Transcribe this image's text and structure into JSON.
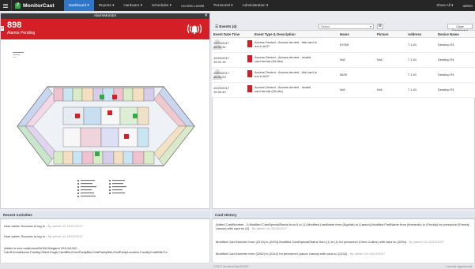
{
  "nav": {
    "menu_icon": "menu-icon",
    "brand": "MonitorCast",
    "items": [
      {
        "label": "Dashboard ▾",
        "active": true
      },
      {
        "label": "Reports ▾"
      },
      {
        "label": "Hardware ▾"
      },
      {
        "label": "Schedules ▾"
      },
      {
        "label": "Access Levels"
      },
      {
        "label": "Personnel ▾"
      },
      {
        "label": "Administration ▾"
      }
    ],
    "show_all": "Show All ▾",
    "user": "admin"
  },
  "alarm": {
    "title": "AlarmMonitor",
    "close": "✕",
    "count": "898",
    "subtitle": "Alarms Pending",
    "toggle": "≡",
    "bell_icon": "alarm-bell-icon"
  },
  "events": {
    "label": "Events (4)",
    "select_value": "Select",
    "select_arrow": "▾",
    "gear": "⚙",
    "clear_button": "Clear Dashboard",
    "columns": [
      "Event Date Time",
      "Event Type & Description",
      "Name",
      "Picture",
      "Address",
      "Device Name"
    ],
    "rows": [
      {
        "datetime": "10/20/2017 15:32:31",
        "description": "Access Denied - Access denied - this card is not in ACP",
        "name": "67006",
        "picture": "",
        "address": "7.1.#1",
        "device": "Desktop R1"
      },
      {
        "datetime": "10/20/2017 15:31:14",
        "description": "Access Denied - Access denied - Invalid card format (34 bits)",
        "name": "N/A",
        "picture": "N/A",
        "address": "7.1.#1",
        "device": "Desktop R1"
      },
      {
        "datetime": "10/20/2017 15:31:29",
        "description": "Access Denied - Access denied - this card is not in ACP",
        "name": "5829",
        "picture": "",
        "address": "7.1.#1",
        "device": "Desktop R1"
      },
      {
        "datetime": "10/20/2017 15:30:40",
        "description": "Access Denied - Access denied - Invalid card format (26 bits)",
        "name": "N/A",
        "picture": "N/A",
        "address": "7.1.#1",
        "device": "Desktop R1"
      }
    ]
  },
  "recent": {
    "title": "Recent Activities",
    "items": [
      {
        "text": "User admin Success to log in",
        "meta": " - By admin On 10/20/2017"
      },
      {
        "text": "User admin Success to log in",
        "meta": " - By admin On 10/20/2017"
      },
      {
        "text": "Added a new cardformat34 Bit Wiegand H10-N1002 - CardFormatName,Facility,Offset,Flags,CardBits,EvenParityBits,OddParityBits,OddParityLocation,FacilityCodeBits,Fa",
        "meta": ""
      }
    ]
  },
  "history": {
    "title": "Card History",
    "items": [
      {
        "text": "Added CardNumber - 0,Modified CardSpecialStatus from 0 to (1),Modified LastName from (Aguilar) to (Larson),Modified FirstName from (fernando) to (Freddy) for personnel (Freddy Larson) with card no (0)",
        "meta": " - By admin On 10/19/2017"
      },
      {
        "text": "Modified Card Number from (2214) to (2294),Modified CardSpecialStatus from (1) to (1) for personnel (Chris Collins) with card no (2294)",
        "meta": " - By admin On 10/13/2017"
      },
      {
        "text": "Modified Card Number from (2282) to (2242) for personnel (Jason Garcia) with card no (2242)",
        "meta": " - By admin On 10/13/2017"
      }
    ]
  },
  "footer": {
    "copyright": "©2017 MonitorCast-EDGE",
    "version": "License Agreement"
  },
  "colors": {
    "alarm_red": "#d51f26",
    "nav_bg": "#262626",
    "nav_active": "#2f76c8",
    "brand_green": "#3aa64a"
  }
}
